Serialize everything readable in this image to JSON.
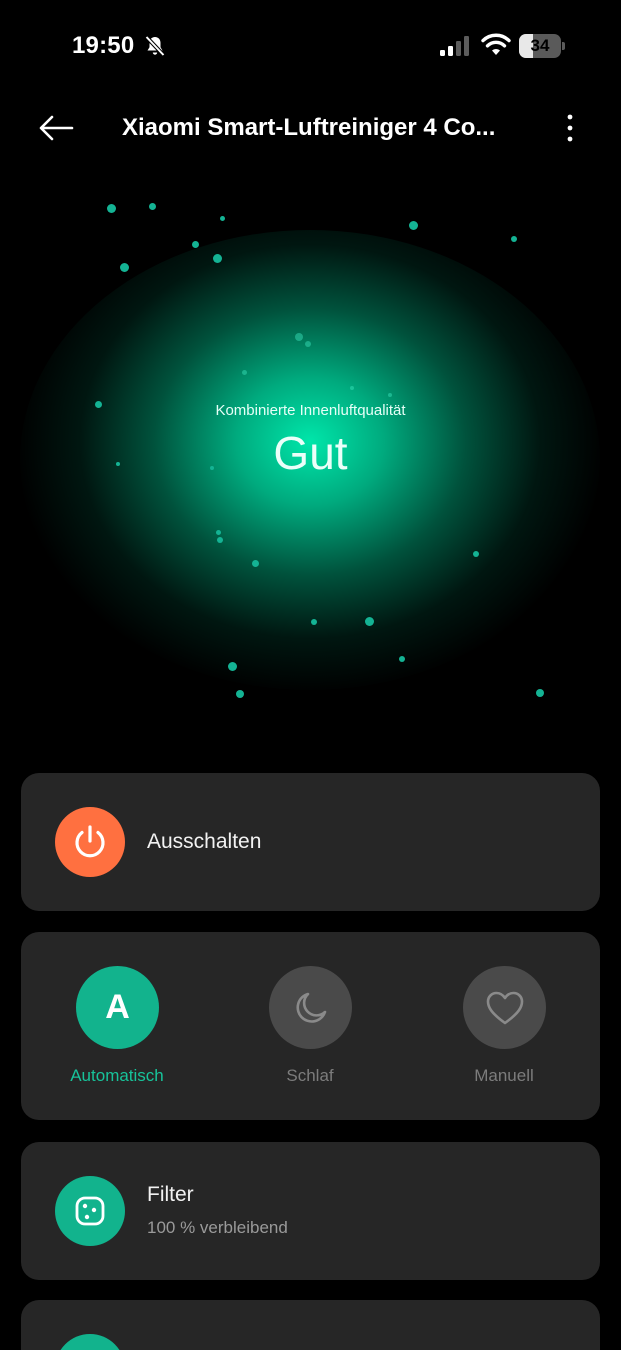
{
  "status_bar": {
    "time": "19:50",
    "battery_level": "34",
    "battery_fraction": 0.34,
    "icons": [
      "bell-off-icon",
      "signal-icon",
      "wifi-icon",
      "battery-icon"
    ]
  },
  "header": {
    "title": "Xiaomi Smart-Luftreiniger 4 Co...",
    "back_icon": "arrow-left-icon",
    "more_icon": "more-vertical-icon"
  },
  "air_quality": {
    "label": "Kombinierte Innenluftqualität",
    "value": "Gut",
    "glow_color": "#00e6aa"
  },
  "power": {
    "label": "Ausschalten",
    "icon": "power-icon",
    "color": "#ff7040"
  },
  "modes": {
    "items": [
      {
        "label": "Automatisch",
        "icon": "letter-a-icon",
        "active": true
      },
      {
        "label": "Schlaf",
        "icon": "moon-icon",
        "active": false
      },
      {
        "label": "Manuell",
        "icon": "heart-icon",
        "active": false
      }
    ],
    "active_color": "#12b38d"
  },
  "filter": {
    "title": "Filter",
    "status": "100 % verbleibend",
    "remaining_fraction": 1.0,
    "icon": "filter-icon"
  }
}
